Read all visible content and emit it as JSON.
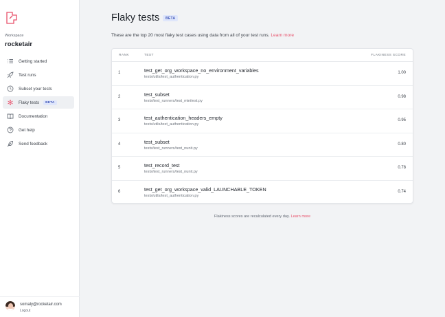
{
  "colors": {
    "accent": "#e8506a",
    "badge_bg": "#dfe6fb",
    "badge_text": "#3f56b8",
    "background": "#f2f3f5"
  },
  "sidebar": {
    "workspace_label": "Workspace",
    "workspace_name": "rocketair",
    "items": [
      {
        "label": "Getting started",
        "icon": "list-icon"
      },
      {
        "label": "Test runs",
        "icon": "rocket-icon"
      },
      {
        "label": "Subset your tests",
        "icon": "clock-icon"
      },
      {
        "label": "Flaky tests",
        "icon": "snowflake-icon",
        "badge": "BETA",
        "active": true
      },
      {
        "label": "Documentation",
        "icon": "book-icon"
      },
      {
        "label": "Get help",
        "icon": "help-circle-icon"
      },
      {
        "label": "Send feedback",
        "icon": "feather-icon"
      }
    ],
    "user": {
      "email": "somaly@rocketair.com",
      "logout_label": "Logout"
    }
  },
  "main": {
    "title": "Flaky tests",
    "title_badge": "BETA",
    "intro_text": "These are the top 20 most flaky test cases using data from all of your test runs. ",
    "intro_link": "Learn more",
    "table": {
      "headers": {
        "rank": "RANK",
        "test": "TEST",
        "score": "FLAKINESS SCORE"
      },
      "rows": [
        {
          "rank": "1",
          "name": "test_get_org_workspace_no_environment_variables",
          "path": "tests/utils/test_authentication.py",
          "score": "1.00"
        },
        {
          "rank": "2",
          "name": "test_subset",
          "path": "tests/test_runners/test_minitest.py",
          "score": "0.98"
        },
        {
          "rank": "3",
          "name": "test_authentication_headers_empty",
          "path": "tests/utils/test_authentication.py",
          "score": "0.95"
        },
        {
          "rank": "4",
          "name": "test_subset",
          "path": "tests/test_runners/test_nunit.py",
          "score": "0.80"
        },
        {
          "rank": "5",
          "name": "test_record_test",
          "path": "tests/test_runners/test_nunit.py",
          "score": "0.78"
        },
        {
          "rank": "6",
          "name": "test_get_org_workspace_valid_LAUNCHABLE_TOKEN",
          "path": "tests/utils/test_authentication.py",
          "score": "0.74"
        }
      ]
    },
    "footer_text": "Flakiness scores are recalculated every day. ",
    "footer_link": "Learn more"
  }
}
